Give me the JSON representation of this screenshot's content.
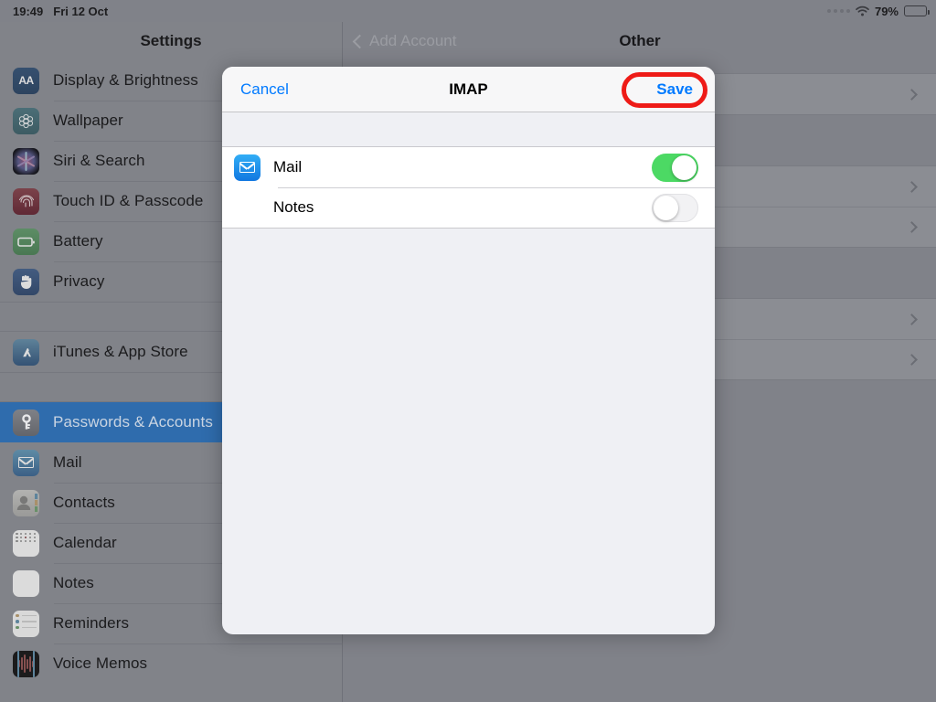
{
  "status_bar": {
    "time": "19:49",
    "date": "Fri 12 Oct",
    "battery_percent": "79%",
    "wifi_icon": "wifi-icon",
    "battery_icon": "battery-icon",
    "signal_icon": "signal-dots-icon"
  },
  "sidebar": {
    "title": "Settings",
    "items": [
      {
        "label": "Display & Brightness",
        "icon": "display-brightness-icon",
        "selected": false
      },
      {
        "label": "Wallpaper",
        "icon": "wallpaper-icon",
        "selected": false
      },
      {
        "label": "Siri & Search",
        "icon": "siri-search-icon",
        "selected": false
      },
      {
        "label": "Touch ID & Passcode",
        "icon": "touch-id-icon",
        "selected": false
      },
      {
        "label": "Battery",
        "icon": "battery-settings-icon",
        "selected": false
      },
      {
        "label": "Privacy",
        "icon": "privacy-icon",
        "selected": false
      },
      {
        "label": "iTunes & App Store",
        "icon": "itunes-app-store-icon",
        "selected": false
      },
      {
        "label": "Passwords & Accounts",
        "icon": "passwords-accounts-icon",
        "selected": true
      },
      {
        "label": "Mail",
        "icon": "mail-icon",
        "selected": false
      },
      {
        "label": "Contacts",
        "icon": "contacts-icon",
        "selected": false
      },
      {
        "label": "Calendar",
        "icon": "calendar-icon",
        "selected": false
      },
      {
        "label": "Notes",
        "icon": "notes-icon",
        "selected": false
      },
      {
        "label": "Reminders",
        "icon": "reminders-icon",
        "selected": false
      },
      {
        "label": "Voice Memos",
        "icon": "voice-memos-icon",
        "selected": false
      }
    ]
  },
  "detail_panel": {
    "back_label": "Add Account",
    "back_icon": "chevron-left-icon",
    "title": "Other",
    "rows": [
      {
        "chevron": "chevron-right-icon"
      },
      {
        "chevron": "chevron-right-icon"
      },
      {
        "chevron": "chevron-right-icon"
      },
      {
        "chevron": "chevron-right-icon"
      },
      {
        "chevron": "chevron-right-icon"
      }
    ]
  },
  "modal": {
    "cancel_label": "Cancel",
    "title": "IMAP",
    "save_label": "Save",
    "save_highlight_color": "#ee1b17",
    "accent_color": "#007aff",
    "toggle_on_color": "#4cd964",
    "rows": [
      {
        "label": "Mail",
        "icon": "mail-app-icon",
        "toggle": "on"
      },
      {
        "label": "Notes",
        "icon": "notes-app-icon",
        "toggle": "off"
      }
    ]
  }
}
